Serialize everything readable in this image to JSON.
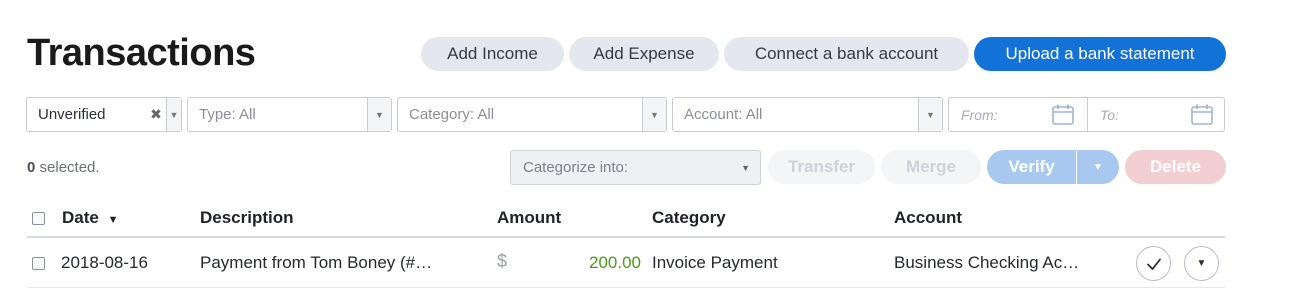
{
  "page": {
    "title": "Transactions"
  },
  "header_buttons": {
    "add_income": "Add Income",
    "add_expense": "Add Expense",
    "connect_bank": "Connect a bank account",
    "upload_statement": "Upload a bank statement"
  },
  "filters": {
    "status": {
      "value": "Unverified"
    },
    "type": {
      "value": "Type: All"
    },
    "category": {
      "value": "Category: All"
    },
    "account": {
      "value": "Account: All"
    },
    "date_from": {
      "placeholder": "From:"
    },
    "date_to": {
      "placeholder": "To:"
    }
  },
  "actions": {
    "selected_count": "0",
    "selected_suffix": "selected.",
    "categorize_into": "Categorize into:",
    "transfer": "Transfer",
    "merge": "Merge",
    "verify": "Verify",
    "delete": "Delete"
  },
  "table": {
    "columns": {
      "date": "Date",
      "description": "Description",
      "amount": "Amount",
      "category": "Category",
      "account": "Account"
    },
    "sort_indicator": "▼",
    "rows": [
      {
        "date": "2018-08-16",
        "description": "Payment from Tom Boney (#…",
        "currency": "$",
        "amount": "200.00",
        "category": "Invoice Payment",
        "account": "Business Checking Ac…"
      }
    ]
  },
  "colors": {
    "primary": "#1372d8",
    "amount_positive": "#4e9a1a",
    "verify_disabled": "#a9c8ef",
    "delete_disabled": "#f4cfd2"
  },
  "icons": [
    "clear-icon",
    "chevron-down-icon",
    "calendar-icon",
    "checkmark-icon",
    "sort-down-icon"
  ]
}
